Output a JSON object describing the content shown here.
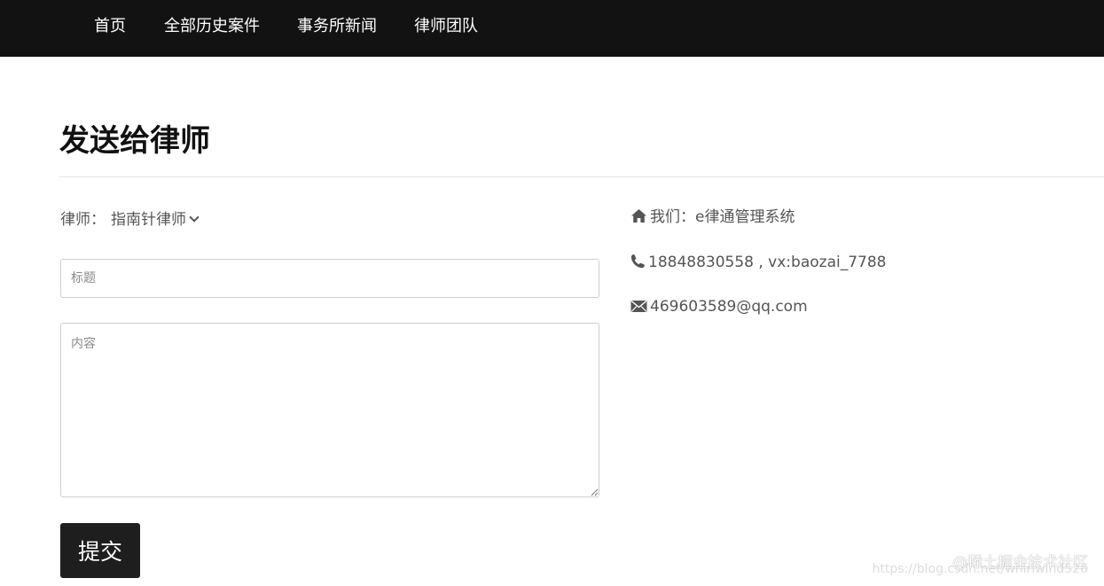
{
  "nav": {
    "items": [
      {
        "label": "首页"
      },
      {
        "label": "全部历史案件"
      },
      {
        "label": "事务所新闻"
      },
      {
        "label": "律师团队"
      }
    ]
  },
  "main": {
    "title": "发送给律师",
    "lawyer_label": "律师：",
    "lawyer_selected": "指南针律师",
    "title_placeholder": "标题",
    "content_placeholder": "内容",
    "submit_label": "提交"
  },
  "contact": {
    "about": "我们：e律通管理系统",
    "phone": "18848830558 , vx:baozai_7788",
    "email": "469603589@qq.com"
  },
  "watermark": {
    "text": "@稀土掘金技术社区",
    "url": "https://blog.csdn.net/whirlwind526"
  },
  "icons": {
    "home": "home-icon",
    "phone": "phone-icon",
    "email": "envelope-icon",
    "dropdown": "chevron-down-icon"
  },
  "colors": {
    "navbar_bg": "#121212",
    "button_bg": "#1e1e1e",
    "text": "#555555"
  }
}
